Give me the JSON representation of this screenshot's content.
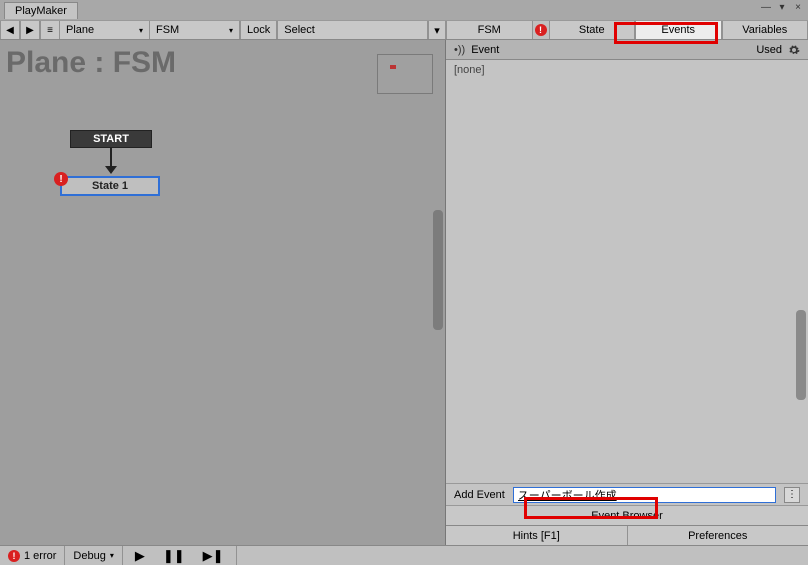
{
  "titlebar": {
    "tab": "PlayMaker"
  },
  "toolbar": {
    "left": {
      "nav_prev": "◀",
      "nav_next": "▶",
      "list": "≡",
      "target_dropdown": "Plane",
      "fsm_dropdown": "FSM",
      "lock": "Lock",
      "select": "Select"
    },
    "right": {
      "tabs": {
        "fsm": "FSM",
        "state": "State",
        "events": "Events",
        "variables": "Variables"
      }
    }
  },
  "canvas": {
    "title": "Plane : FSM",
    "start": "START",
    "state1": "State 1"
  },
  "subtoolbar": {
    "icon": "•))",
    "label": "Event",
    "used": "Used"
  },
  "events": {
    "none": "[none]"
  },
  "add_event": {
    "label": "Add Event",
    "value": "スーパーボール作成",
    "menu": "⋮"
  },
  "event_browser": "Event Browser",
  "footer": {
    "hints": "Hints [F1]",
    "prefs": "Preferences"
  },
  "status": {
    "error_count": "1 error",
    "debug": "Debug"
  }
}
